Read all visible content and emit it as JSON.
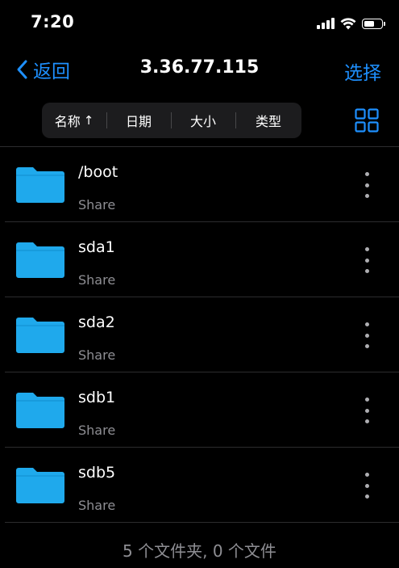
{
  "status_bar": {
    "time": "7:20",
    "icons": [
      "signal-icon",
      "wifi-icon",
      "battery-icon"
    ]
  },
  "nav": {
    "back_label": "返回",
    "title": "3.36.77.115",
    "select_label": "选择"
  },
  "sort": {
    "name_label": "名称",
    "name_arrow": "↑",
    "date_label": "日期",
    "size_label": "大小",
    "type_label": "类型"
  },
  "files": [
    {
      "name": "/boot",
      "sub": "Share"
    },
    {
      "name": "sda1",
      "sub": "Share"
    },
    {
      "name": "sda2",
      "sub": "Share"
    },
    {
      "name": "sdb1",
      "sub": "Share"
    },
    {
      "name": "sdb5",
      "sub": "Share"
    }
  ],
  "footer": {
    "summary": "5 个文件夹, 0 个文件"
  },
  "colors": {
    "accent": "#1e90ff",
    "folder": "#1fa9ec",
    "background": "#000000",
    "secondary_text": "#8e8e93"
  }
}
